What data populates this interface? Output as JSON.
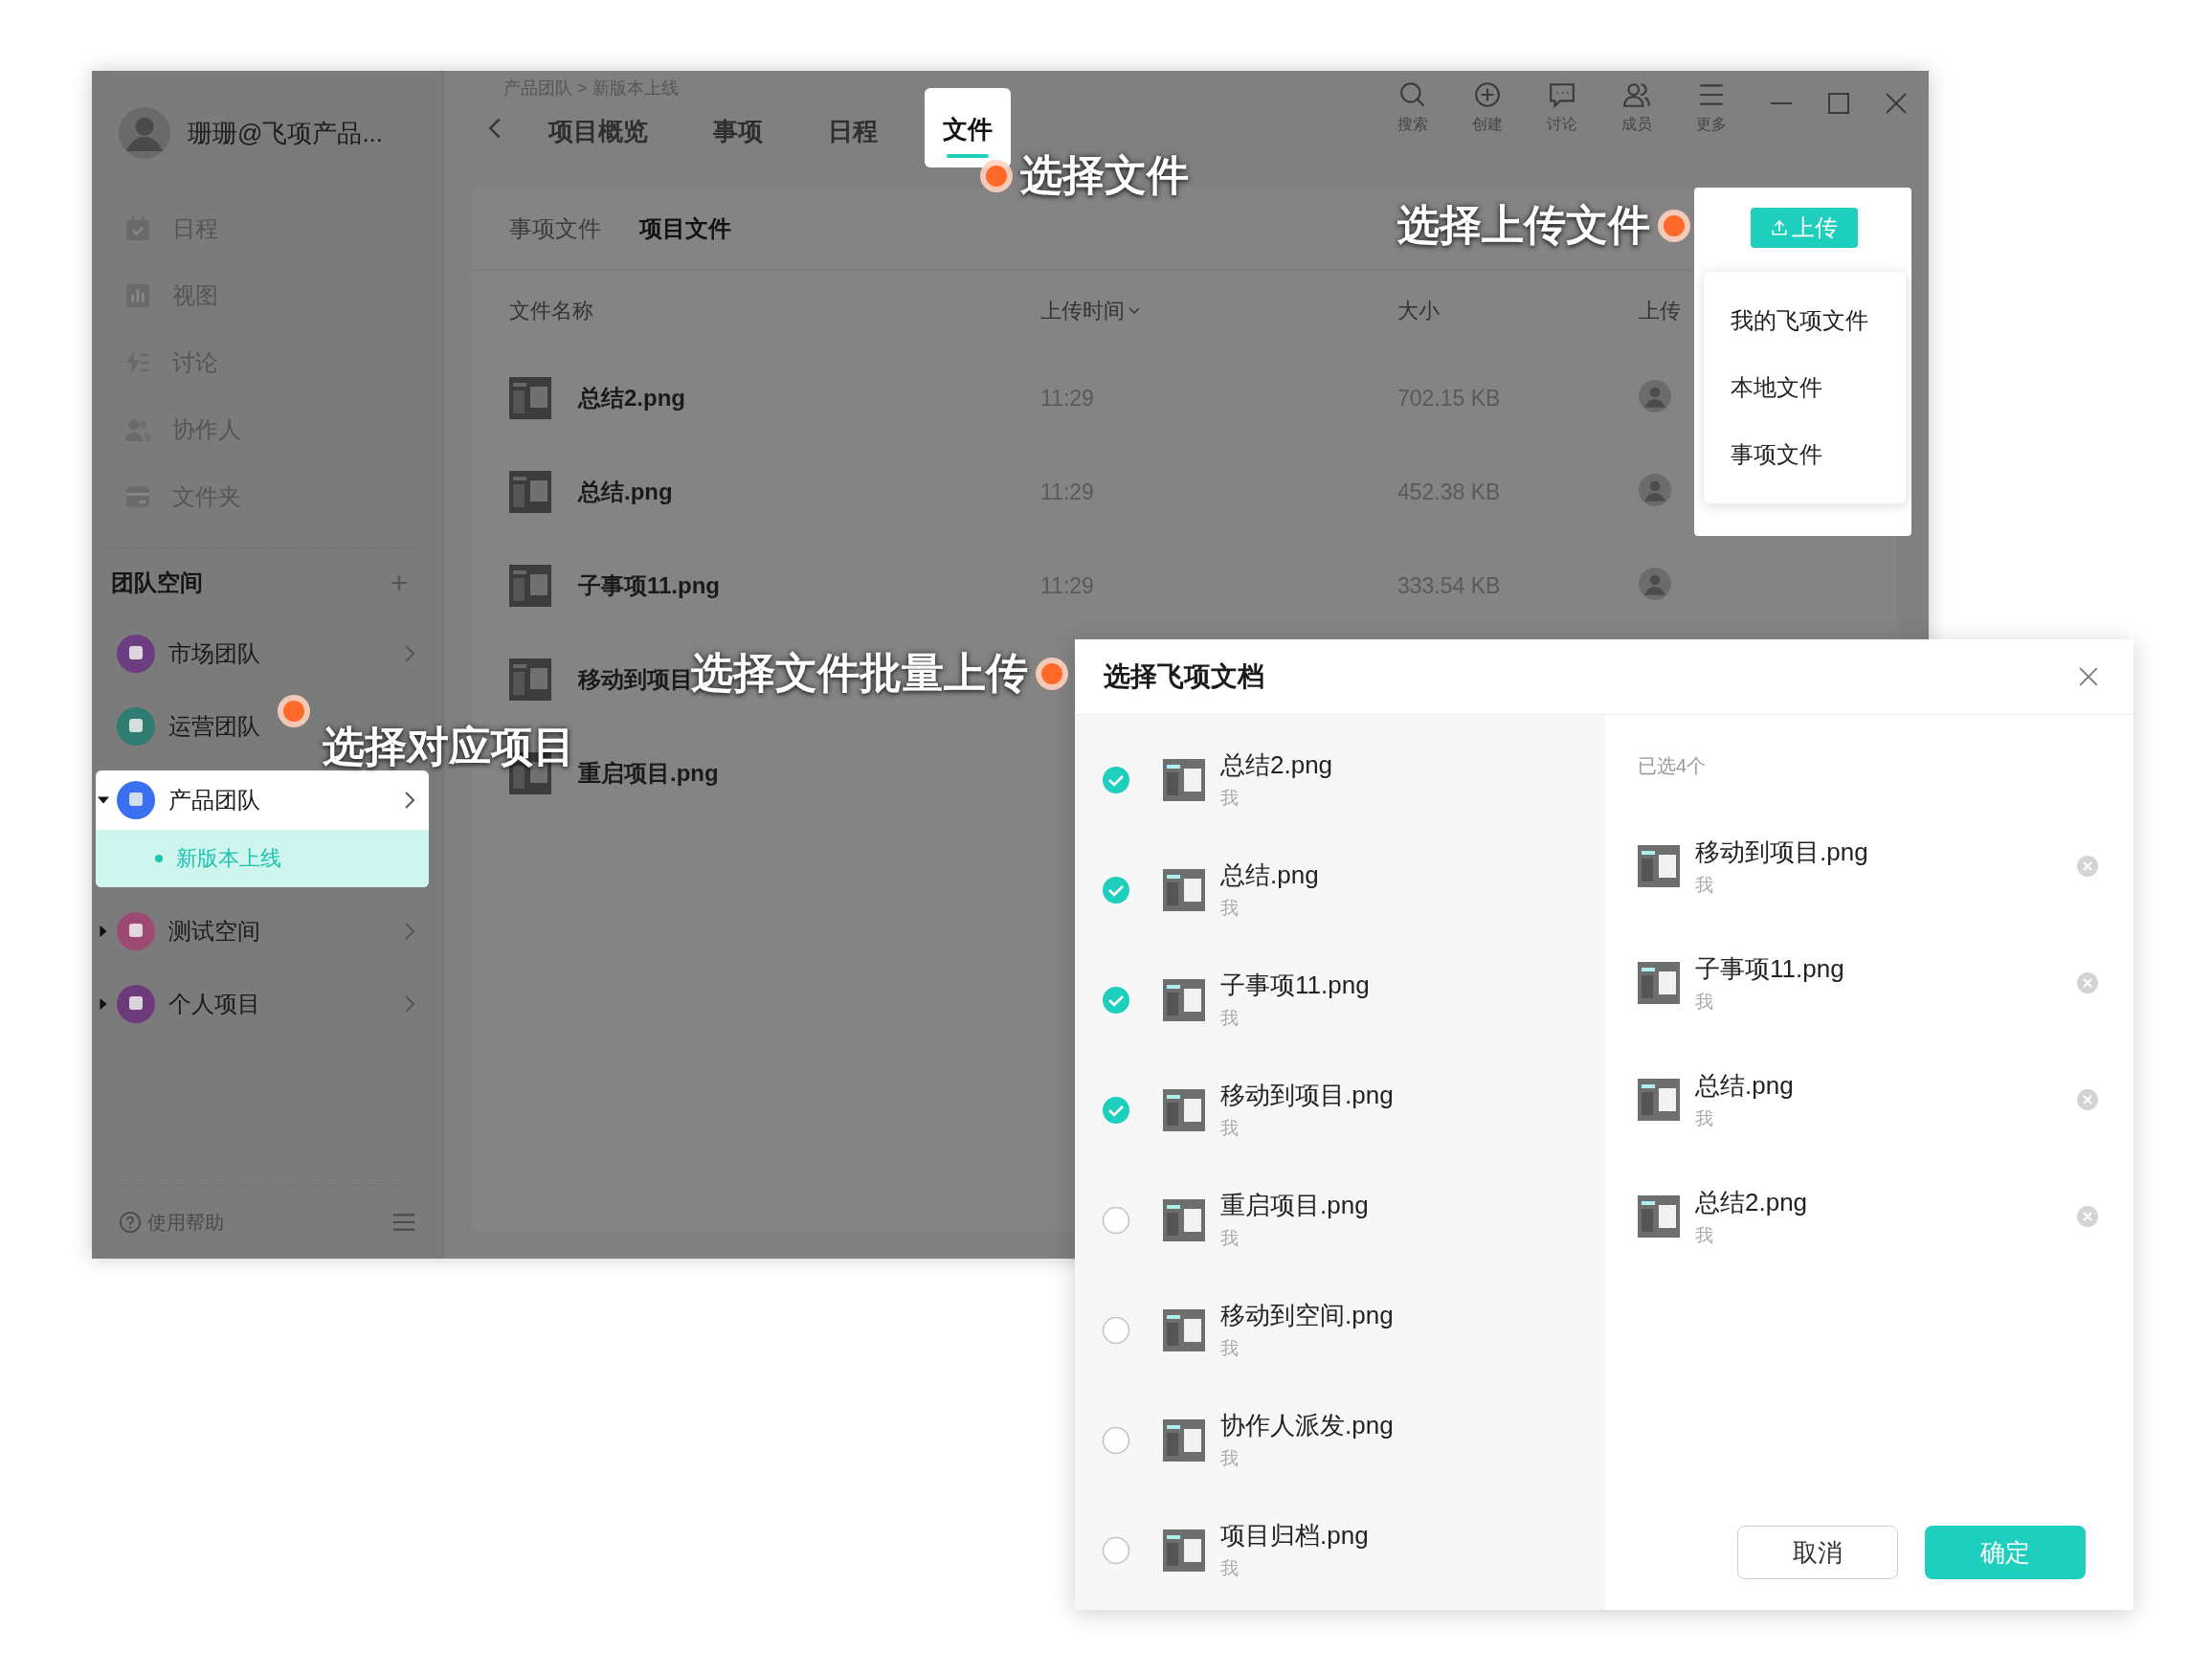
{
  "window": {
    "user_name": "珊珊@飞项产品...",
    "breadcrumb": "产品团队 > 新版本上线",
    "tabs": [
      {
        "label": "项目概览",
        "selected": false
      },
      {
        "label": "事项",
        "selected": false
      },
      {
        "label": "日程",
        "selected": false
      },
      {
        "label": "文件",
        "selected": true
      }
    ],
    "toolbar": [
      {
        "label": "搜索",
        "kind": "search"
      },
      {
        "label": "创建",
        "kind": "create"
      },
      {
        "label": "讨论",
        "kind": "discuss"
      },
      {
        "label": "成员",
        "kind": "members"
      },
      {
        "label": "更多",
        "kind": "more"
      }
    ]
  },
  "sidebar": {
    "nav": [
      {
        "label": "日程",
        "kind": "calendar"
      },
      {
        "label": "视图",
        "kind": "chart"
      },
      {
        "label": "讨论",
        "kind": "discuss"
      },
      {
        "label": "协作人",
        "kind": "people"
      },
      {
        "label": "文件夹",
        "kind": "folder"
      }
    ],
    "section_title": "团队空间",
    "teams": [
      {
        "name": "市场团队",
        "color": "#6c3d80",
        "chevron": true,
        "selected": false
      },
      {
        "name": "运营团队",
        "color": "#2f7d72",
        "chevron": false,
        "selected": false
      },
      {
        "name": "产品团队",
        "color": "#3a6ff0",
        "expanded": true,
        "chevron": true,
        "selected": true,
        "children": [
          {
            "name": "新版本上线",
            "selected": true
          }
        ]
      },
      {
        "name": "测试空间",
        "color": "#9c4a72",
        "expanded": false,
        "chevron": true,
        "selected": false
      },
      {
        "name": "个人项目",
        "color": "#6d3a7c",
        "expanded": false,
        "chevron": true,
        "selected": false
      }
    ],
    "help": "使用帮助"
  },
  "content": {
    "subtabs": [
      {
        "label": "事项文件",
        "selected": false
      },
      {
        "label": "项目文件",
        "selected": true
      }
    ],
    "columns": [
      {
        "label": "文件名称",
        "sorted": false
      },
      {
        "label": "上传时间",
        "sorted": true
      },
      {
        "label": "大小",
        "sorted": false
      },
      {
        "label": "上传",
        "sorted": false
      }
    ],
    "rows": [
      {
        "name": "总结2.png",
        "time": "11:29",
        "size": "702.15 KB"
      },
      {
        "name": "总结.png",
        "time": "11:29",
        "size": "452.38 KB"
      },
      {
        "name": "子事项11.png",
        "time": "11:29",
        "size": "333.54 KB"
      },
      {
        "name": "移动到项目"
      },
      {
        "name": "重启项目.png"
      }
    ],
    "upload": {
      "button": "上传",
      "menu": [
        "我的飞项文件",
        "本地文件",
        "事项文件"
      ]
    }
  },
  "dialog": {
    "title": "选择飞项文档",
    "files": [
      {
        "name": "总结2.png",
        "owner": "我",
        "checked": true
      },
      {
        "name": "总结.png",
        "owner": "我",
        "checked": true
      },
      {
        "name": "子事项11.png",
        "owner": "我",
        "checked": true
      },
      {
        "name": "移动到项目.png",
        "owner": "我",
        "checked": true
      },
      {
        "name": "重启项目.png",
        "owner": "我",
        "checked": false
      },
      {
        "name": "移动到空间.png",
        "owner": "我",
        "checked": false
      },
      {
        "name": "协作人派发.png",
        "owner": "我",
        "checked": false
      },
      {
        "name": "项目归档.png",
        "owner": "我",
        "checked": false
      }
    ],
    "selected_count": "已选4个",
    "selected": [
      {
        "name": "移动到项目.png",
        "owner": "我"
      },
      {
        "name": "子事项11.png",
        "owner": "我"
      },
      {
        "name": "总结.png",
        "owner": "我"
      },
      {
        "name": "总结2.png",
        "owner": "我"
      }
    ],
    "cancel": "取消",
    "confirm": "确定"
  },
  "callouts": [
    "选择文件",
    "选择上传文件",
    "选择对应项目",
    "选择文件批量上传"
  ]
}
